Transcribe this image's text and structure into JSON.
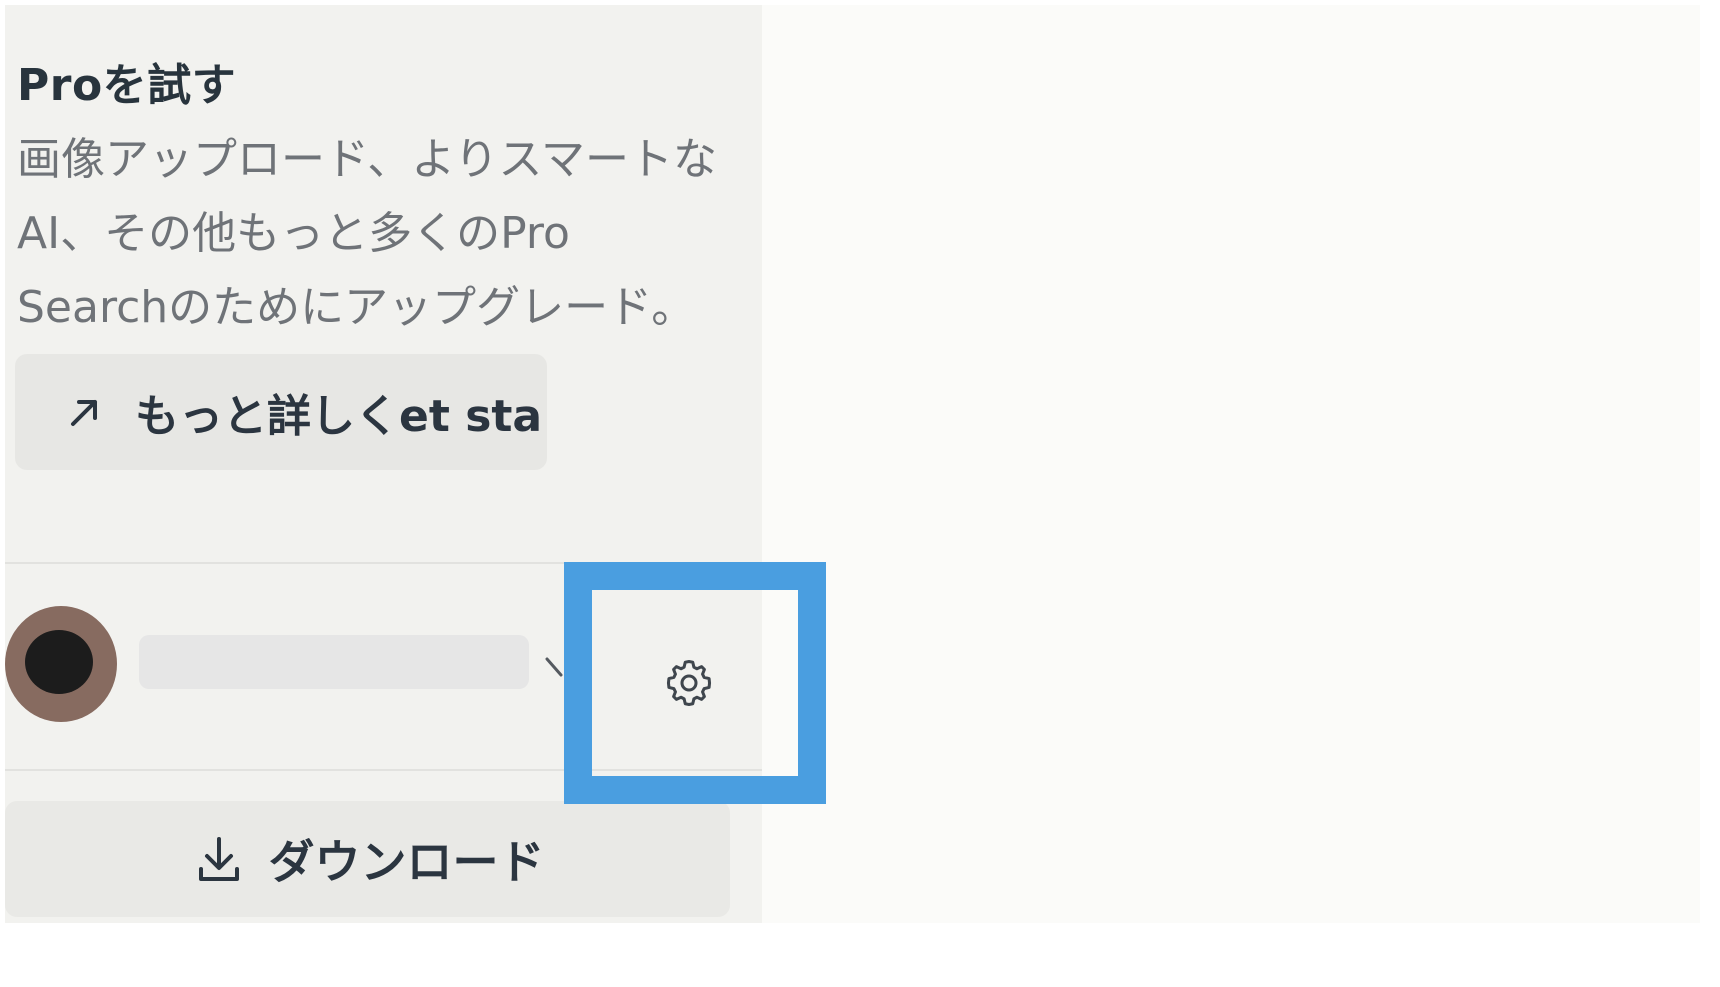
{
  "promo": {
    "title": "Proを試す",
    "body_lines": [
      "画像アップロード、よりスマートな",
      "AI、その他もっと多くのPro",
      "Searchのためにアップグレード。"
    ],
    "learn_more_label": "もっと詳しくet sta"
  },
  "user": {
    "avatar_colors": {
      "ring": "#876b60",
      "center": "#1c1c1c"
    }
  },
  "settings": {
    "highlight_color": "#4a9ee0"
  },
  "download": {
    "label": "ダウンロード"
  },
  "icons": {
    "learn_more": "arrow-up-right-icon",
    "menu": "chevron-down-icon",
    "settings": "gear-icon",
    "download": "download-icon"
  }
}
